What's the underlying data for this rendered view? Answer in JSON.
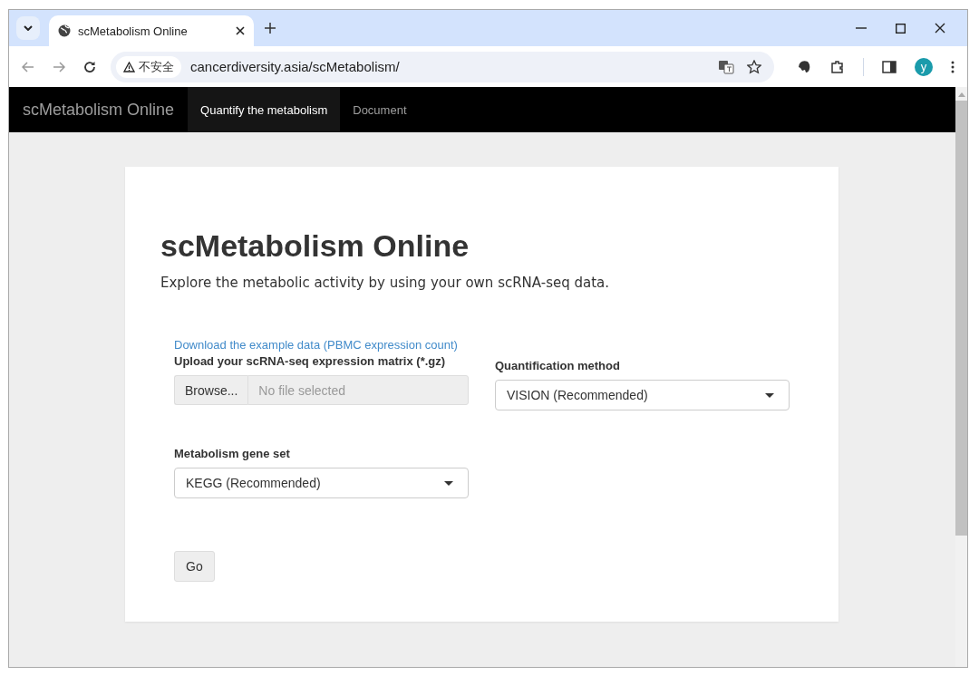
{
  "browser": {
    "tabs": [
      {
        "title": "scMetabolism Online",
        "selected": true
      }
    ],
    "security_label": "不安全",
    "url": "cancerdiversity.asia/scMetabolism/",
    "profile_initial": "y"
  },
  "navbar": {
    "brand": "scMetabolism Online",
    "items": [
      {
        "label": "Quantify the metabolism",
        "selected": true
      },
      {
        "label": "Document",
        "selected": false
      }
    ]
  },
  "page": {
    "title": "scMetabolism Online",
    "subtitle": "Explore the metabolic activity by using your own scRNA-seq data.",
    "download_link": "Download the example data (PBMC expression count)",
    "upload": {
      "label": "Upload your scRNA-seq expression matrix (*.gz)",
      "button": "Browse...",
      "placeholder": "No file selected"
    },
    "method": {
      "label": "Quantification method",
      "value": "VISION (Recommended)"
    },
    "gene_set": {
      "label": "Metabolism gene set",
      "value": "KEGG (Recommended)"
    },
    "submit": "Go"
  }
}
